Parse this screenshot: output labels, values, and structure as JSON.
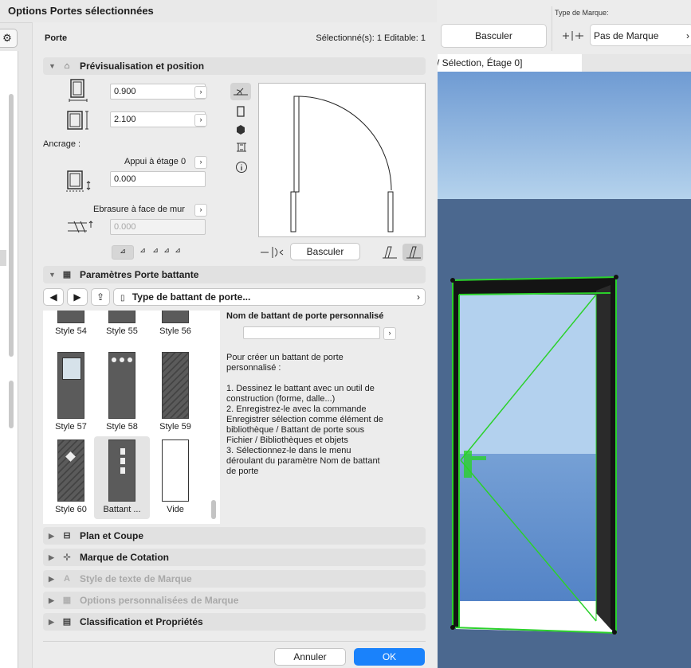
{
  "window": {
    "title": "Options Portes sélectionnées"
  },
  "header": {
    "element_type": "Porte",
    "selection_info": "Sélectionné(s): 1 Editable: 1"
  },
  "preview_section": {
    "title": "Prévisualisation et position",
    "width_value": "0.900",
    "height_value": "2.100",
    "anchor_label": "Ancrage :",
    "anchor_ref": "Appui à étage 0",
    "anchor_value": "0.000",
    "reveal_label": "Ebrasure à face de mur",
    "reveal_value": "0.000",
    "flip_button": "Basculer"
  },
  "leaf_section": {
    "title": "Paramètres Porte battante",
    "leaf_type": "Type de battant de porte...",
    "custom_name_label": "Nom de battant de porte personnalisé",
    "custom_name_value": "",
    "instructions": [
      "Pour créer un battant de porte",
      "personnalisé :",
      "",
      "1. Dessinez le battant avec un outil de",
      "construction (forme, dalle...)",
      "2. Enregistrez-le avec la commande",
      "Enregistrer sélection comme élément de",
      "bibliothèque / Battant de porte sous",
      "Fichier / Bibliothèques et objets",
      "3. Sélectionnez-le dans le menu",
      "déroulant du paramètre Nom de battant",
      "de porte"
    ],
    "styles": [
      {
        "label": "Style 54"
      },
      {
        "label": "Style 55"
      },
      {
        "label": "Style 56"
      },
      {
        "label": "Style 57"
      },
      {
        "label": "Style 58"
      },
      {
        "label": "Style 59"
      },
      {
        "label": "Style 60"
      },
      {
        "label": "Battant ..."
      },
      {
        "label": "Vide"
      }
    ],
    "selected_style": "Battant ..."
  },
  "collapsed_sections": [
    {
      "label": "Plan et Coupe",
      "enabled": true
    },
    {
      "label": "Marque de Cotation",
      "enabled": true
    },
    {
      "label": "Style de texte de Marque",
      "enabled": false
    },
    {
      "label": "Options personnalisées de Marque",
      "enabled": false
    },
    {
      "label": "Classification et Propriétés",
      "enabled": true
    }
  ],
  "footer": {
    "cancel": "Annuler",
    "ok": "OK"
  },
  "background_app": {
    "flip_button": "Basculer",
    "marker_type_label": "Type de Marque:",
    "marker_type_value": "Pas de Marque",
    "tab_label": "/ Sélection, Étage 0]"
  },
  "colors": {
    "accent": "#1a82fb",
    "selection_outline": "#2bd12b",
    "wall": "#4e6b92",
    "sky": "#9ec6e8"
  }
}
